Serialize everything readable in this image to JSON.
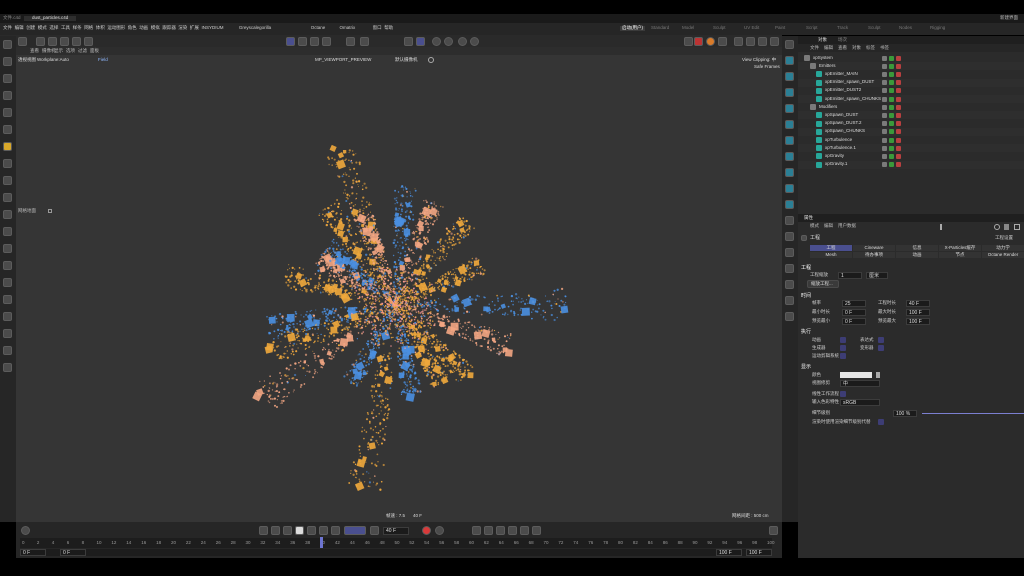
{
  "title_bar": {
    "tabs": [
      "文件.c4d",
      "dust_particles.c4d"
    ],
    "right_label": "新建界面"
  },
  "menu": {
    "items": [
      "文件",
      "编辑",
      "创建",
      "模式",
      "选择",
      "工具",
      "样条",
      "网格",
      "体积",
      "运动图形",
      "角色",
      "动画",
      "模拟",
      "跟踪器",
      "渲染",
      "扩展",
      "INSYDIUM",
      "Greyscalegorilla",
      "Octane",
      "Omatrix",
      "窗口",
      "帮助"
    ]
  },
  "layout_tabs": {
    "items": [
      "启动(用户)",
      "Standard",
      "Model",
      "Sculpt",
      "UV Edit",
      "Paint",
      "Script",
      "Track",
      "Sculpt",
      "Nodes",
      "Rigging"
    ]
  },
  "viewport": {
    "header_items": [
      "查看",
      "摄像机",
      "显示",
      "选项",
      "过滤",
      "面板"
    ],
    "camera_label": "透视视图",
    "workplane": "Workplane:Auto",
    "field": "Field",
    "preview_label": "MP_VIEWPORT_PREVIEW",
    "camera_name": "默认摄像机",
    "clipping": "View Clipping: 中",
    "safe_frames": "Safe Frames",
    "side_label": "网格地面",
    "frame_label": "帧速 : 7.5",
    "frame_value": "40 F",
    "grid_label": "网格间距 : 500 cm"
  },
  "object_manager": {
    "tabs": [
      "对象",
      "场次"
    ],
    "menu": [
      "文件",
      "编辑",
      "查看",
      "对象",
      "标签",
      "书签"
    ],
    "objects": [
      {
        "name": "xpSystem",
        "level": 0
      },
      {
        "name": "Emitters",
        "level": 1
      },
      {
        "name": "xpEmitter_MAIN",
        "level": 2
      },
      {
        "name": "xpEmitter_spawn_DUST",
        "level": 2
      },
      {
        "name": "xpEmitter_DUST2",
        "level": 2
      },
      {
        "name": "xpEmitter_spawn_CHUNKS",
        "level": 2
      },
      {
        "name": "Modifiers",
        "level": 1
      },
      {
        "name": "xpSpawn_DUST",
        "level": 2
      },
      {
        "name": "xpSpawn_DUST.2",
        "level": 2
      },
      {
        "name": "xpSpawn_CHUNKS",
        "level": 2
      },
      {
        "name": "xpTurbulence",
        "level": 2
      },
      {
        "name": "xpTurbulence.1",
        "level": 2
      },
      {
        "name": "xpGravity",
        "level": 2
      },
      {
        "name": "xpGravity.1",
        "level": 2
      }
    ]
  },
  "attributes": {
    "tab": "属性",
    "menu": [
      "模式",
      "编辑",
      "用户数据"
    ],
    "section": "工程",
    "right_label": "工程设置",
    "tabs_row1": [
      "工程",
      "Cineware",
      "信息",
      "X-Particles缓存",
      "动力学"
    ],
    "tabs_row2": [
      "Mesh",
      "待办事项",
      "动画",
      "节点",
      "Octane Render"
    ],
    "project_header": "工程",
    "project_scale_label": "工程缩放",
    "project_scale_value": "1",
    "project_scale_unit": "厘米",
    "scale_button": "缩放工程...",
    "time_header": "时间",
    "time_rows": [
      {
        "l1": "帧率",
        "v1": "25",
        "l2": "工程时长",
        "v2": "40 F"
      },
      {
        "l1": "最小时长",
        "v1": "0 F",
        "l2": "最大时长",
        "v2": "100 F"
      },
      {
        "l1": "预览最小",
        "v1": "0 F",
        "l2": "预览最大",
        "v2": "100 F"
      }
    ],
    "exec_header": "执行",
    "exec_rows": [
      {
        "l1": "动画",
        "l2": "表达式"
      },
      {
        "l1": "生成器",
        "l2": "变形器"
      },
      {
        "l1": "运动剪辑系统"
      }
    ],
    "display_header": "显示",
    "color_label": "颜色",
    "view_clip_label": "视图修剪",
    "view_clip_value": "中",
    "linear_label": "线性工作流程",
    "input_color_label": "输入色彩特性",
    "input_color_value": "sRGB",
    "lod_label": "细节级别",
    "lod_value": "100 %",
    "lod_note": "渲染时使用渲染细节级别代替"
  },
  "timeline": {
    "current_frame": "40 F",
    "ticks": [
      "0",
      "2",
      "4",
      "6",
      "8",
      "10",
      "12",
      "14",
      "16",
      "18",
      "20",
      "22",
      "24",
      "26",
      "28",
      "30",
      "32",
      "34",
      "36",
      "38",
      "40",
      "42",
      "44",
      "46",
      "48",
      "50",
      "52",
      "54",
      "56",
      "58",
      "60",
      "62",
      "64",
      "66",
      "68",
      "70",
      "72",
      "74",
      "76",
      "78",
      "80",
      "82",
      "84",
      "86",
      "88",
      "90",
      "92",
      "94",
      "96",
      "98",
      "100"
    ],
    "start": "0 F",
    "start2": "0 F",
    "end": "100 F",
    "end2": "100 F",
    "playhead_fraction": 0.4
  },
  "colors": {
    "accent": "#4a4f8f",
    "dust_blue": "#4a8fe0",
    "dust_orange": "#f0a83c",
    "dust_peach": "#f3a683",
    "dust_pink": "#ff9a9a"
  }
}
